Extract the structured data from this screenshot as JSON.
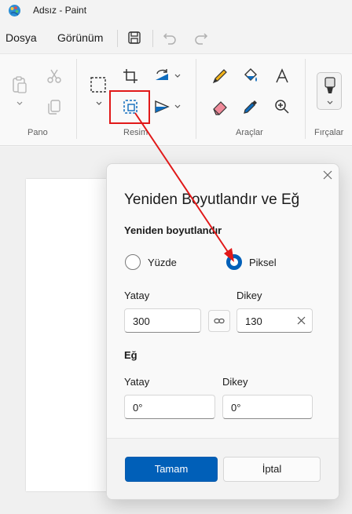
{
  "window": {
    "title": "Adsız - Paint"
  },
  "menubar": {
    "file": "Dosya",
    "view": "Görünüm"
  },
  "ribbon": {
    "groups": {
      "clipboard": "Pano",
      "image": "Resim",
      "tools": "Araçlar",
      "brushes": "Fırçalar"
    }
  },
  "dialog": {
    "title": "Yeniden Boyutlandır ve Eğ",
    "resize_heading": "Yeniden boyutlandır",
    "radio_percent": "Yüzde",
    "radio_pixel": "Piksel",
    "selected_mode": "Piksel",
    "resize_h_label": "Yatay",
    "resize_v_label": "Dikey",
    "resize_h_value": "300",
    "resize_v_value": "130",
    "skew_heading": "Eğ",
    "skew_h_label": "Yatay",
    "skew_v_label": "Dikey",
    "skew_h_value": "0°",
    "skew_v_value": "0°",
    "ok_label": "Tamam",
    "cancel_label": "İptal"
  },
  "colors": {
    "accent": "#005fb8",
    "annotation": "#e11919"
  }
}
